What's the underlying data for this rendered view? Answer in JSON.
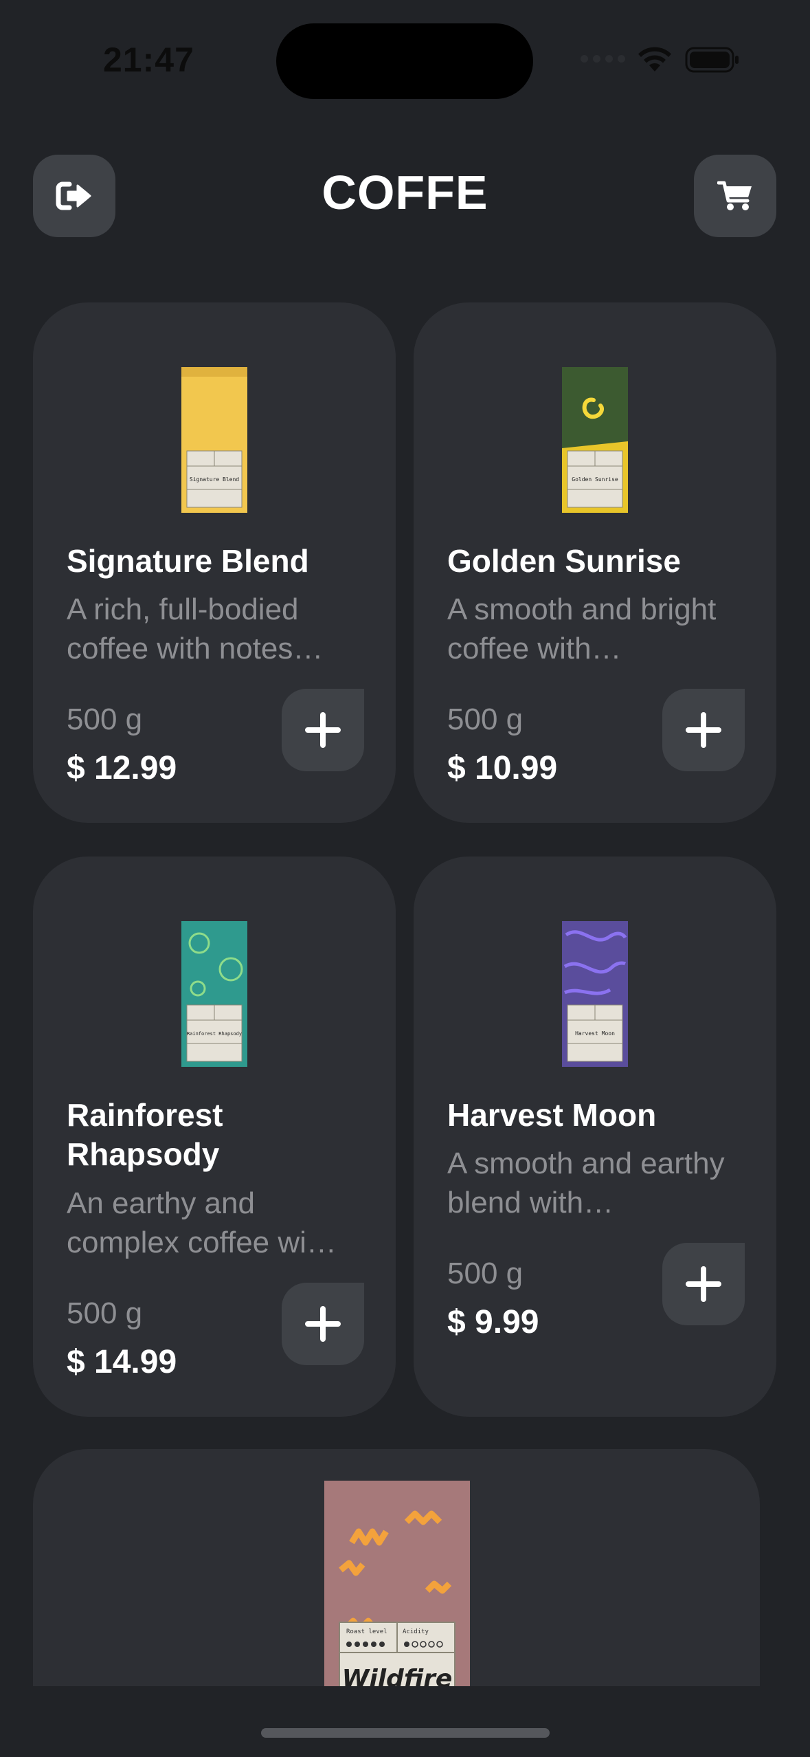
{
  "status_bar": {
    "time": "21:47"
  },
  "header": {
    "title": "COFFE"
  },
  "colors": {
    "background": "#212327",
    "card": "#2d2f34",
    "button": "#3f4247",
    "muted_text": "#8e8f93"
  },
  "products": [
    {
      "name": "Signature Blend",
      "description": "A rich, full-bodied coffee with notes…",
      "weight": "500 g",
      "price": "$ 12.99",
      "bag_label": "Signature Blend",
      "bag_color": "#f2c74e"
    },
    {
      "name": "Golden Sunrise",
      "description": "A smooth and bright coffee with…",
      "weight": "500 g",
      "price": "$ 10.99",
      "bag_label": "Golden Sunrise",
      "bag_color": "#3c5a30"
    },
    {
      "name": "Rainforest Rhapsody",
      "description": "An earthy and complex coffee wi…",
      "weight": "500 g",
      "price": "$ 14.99",
      "bag_label": "Rainforest Rhapsody",
      "bag_color": "#2f9a8e"
    },
    {
      "name": "Harvest Moon",
      "description": "A smooth and earthy blend with…",
      "weight": "500 g",
      "price": "$ 9.99",
      "bag_label": "Harvest Moon",
      "bag_color": "#5a4d9c"
    },
    {
      "name": "",
      "description": "",
      "weight": "",
      "price": "",
      "bag_label": "Wildfire",
      "bag_color": "#a6797a"
    }
  ],
  "bag_panel": {
    "roast_label": "Roast level",
    "acidity_label": "Acidity"
  }
}
